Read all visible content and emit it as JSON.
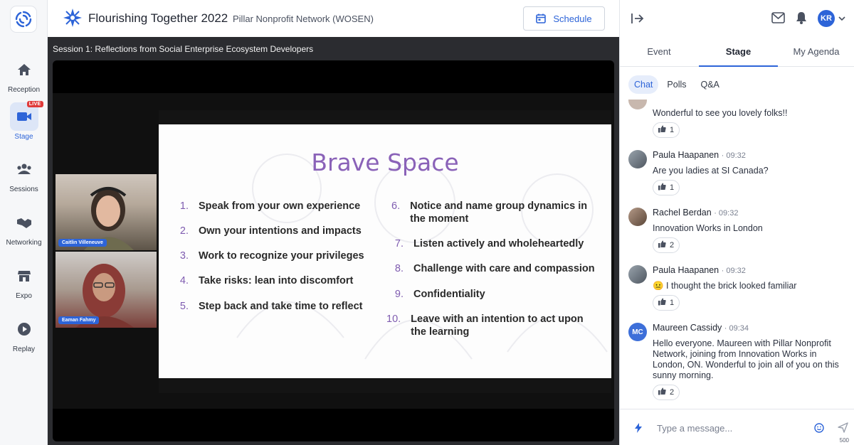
{
  "nav": {
    "items": [
      {
        "label": "Reception",
        "icon": "home-icon"
      },
      {
        "label": "Stage",
        "icon": "camera-icon",
        "badge": "LIVE",
        "active": true
      },
      {
        "label": "Sessions",
        "icon": "people-icon"
      },
      {
        "label": "Networking",
        "icon": "handshake-icon"
      },
      {
        "label": "Expo",
        "icon": "store-icon"
      },
      {
        "label": "Replay",
        "icon": "play-icon"
      }
    ]
  },
  "header": {
    "event_title": "Flourishing Together 2022",
    "org_name": "Pillar Nonprofit Network (WOSEN)",
    "schedule_label": "Schedule"
  },
  "stage": {
    "session_title": "Session 1: Reflections from Social Enterprise Ecosystem Developers",
    "cameras": [
      {
        "name": "Caitlin Villeneuve"
      },
      {
        "name": "Eaman Fahmy"
      }
    ],
    "slide": {
      "title": "Brave Space",
      "left_items": [
        {
          "num": "1.",
          "text": "Speak from your own experience"
        },
        {
          "num": "2.",
          "text": "Own your intentions and impacts"
        },
        {
          "num": "3.",
          "text": "Work to recognize your privileges"
        },
        {
          "num": "4.",
          "text": "Take risks: lean into discomfort"
        },
        {
          "num": "5.",
          "text": "Step back and take time to reflect"
        }
      ],
      "right_items": [
        {
          "num": "6.",
          "text": "Notice and name group dynamics in the moment"
        },
        {
          "num": "7.",
          "text": "Listen actively and wholeheartedly"
        },
        {
          "num": "8.",
          "text": "Challenge with care and compassion"
        },
        {
          "num": "9.",
          "text": "Confidentiality"
        },
        {
          "num": "10.",
          "text": "Leave with an intention to act upon the learning"
        }
      ]
    }
  },
  "panel": {
    "user_initials": "KR",
    "tabs": [
      "Event",
      "Stage",
      "My Agenda"
    ],
    "active_tab": "Stage",
    "subtabs": [
      "Chat",
      "Polls",
      "Q&A"
    ],
    "active_subtab": "Chat",
    "messages": [
      {
        "name": "",
        "time": "",
        "text": "Wonderful to see you lovely folks!!",
        "likes": "1"
      },
      {
        "name": "Paula Haapanen",
        "time": "· 09:32",
        "text": "Are you ladies at SI Canada?",
        "likes": "1"
      },
      {
        "name": "Rachel Berdan",
        "time": "· 09:32",
        "text": "Innovation Works in London",
        "likes": "2"
      },
      {
        "name": "Paula Haapanen",
        "time": "· 09:32",
        "text": "😐 I thought the brick looked familiar",
        "likes": "1"
      },
      {
        "name": "Maureen Cassidy",
        "time": "· 09:34",
        "initials": "MC",
        "text": "Hello everyone. Maureen with Pillar Nonprofit Network, joining from Innovation Works in London, ON. Wonderful to join all of you on this sunny morning.",
        "likes": "2"
      }
    ],
    "composer": {
      "placeholder": "Type a message...",
      "char_limit": "500"
    }
  },
  "colors": {
    "accent": "#2d64d8",
    "live": "#e03a3a",
    "slide_title": "#8a62b8"
  }
}
